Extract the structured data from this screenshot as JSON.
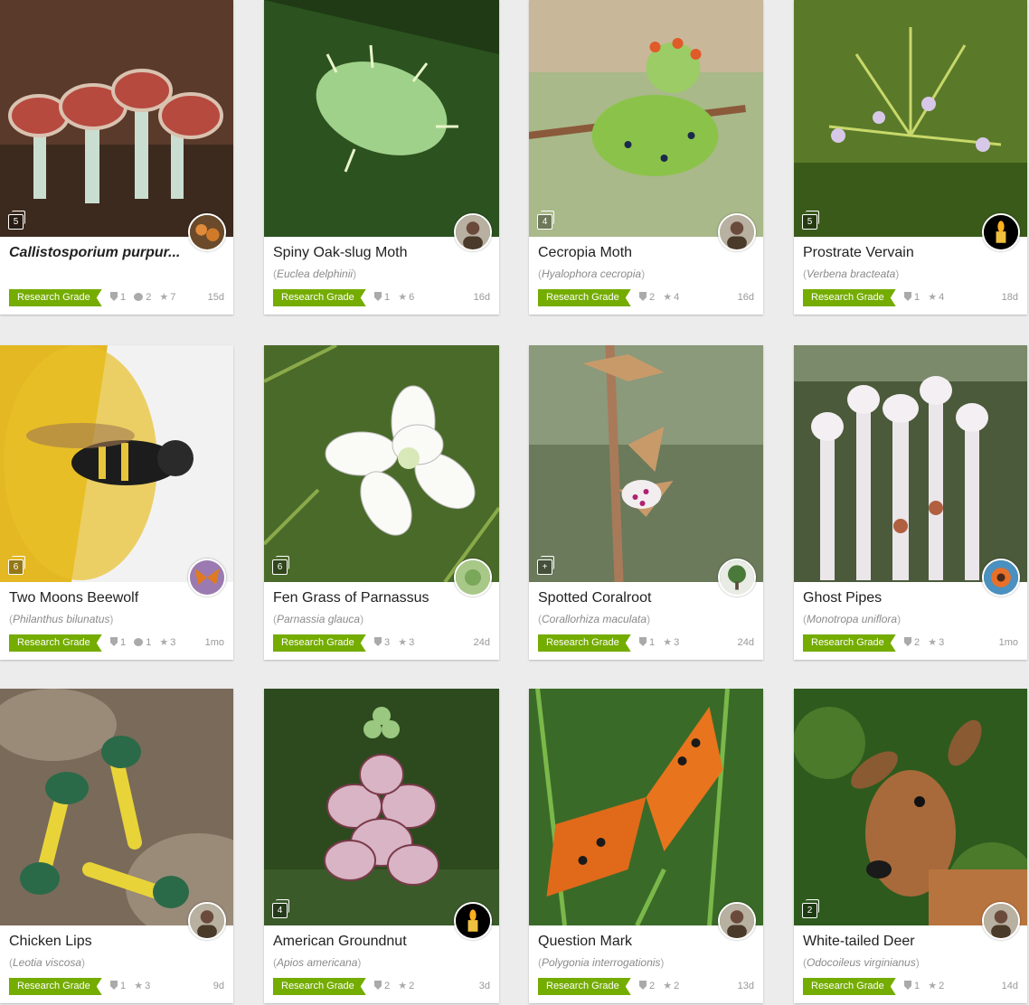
{
  "colors": {
    "research_grade": "#74ac00",
    "background": "#ececec",
    "card": "#ffffff"
  },
  "observations": [
    {
      "title": "Callistosporium purpur...",
      "title_italic": true,
      "scientific": "",
      "grade": "Research Grade",
      "ids": "1",
      "comments": "2",
      "faves": "7",
      "date": "15d",
      "photo_count": "5",
      "photo_icon": "mushroom-photo",
      "avatar_icon": "mushroom-avatar"
    },
    {
      "title": "Spiny Oak-slug Moth",
      "title_italic": false,
      "scientific": "Euclea delphinii",
      "grade": "Research Grade",
      "ids": "1",
      "comments": "",
      "faves": "6",
      "date": "16d",
      "photo_count": "",
      "photo_icon": "caterpillar-photo",
      "avatar_icon": "person-avatar"
    },
    {
      "title": "Cecropia Moth",
      "title_italic": false,
      "scientific": "Hyalophora cecropia",
      "grade": "Research Grade",
      "ids": "2",
      "comments": "",
      "faves": "4",
      "date": "16d",
      "photo_count": "4",
      "photo_icon": "caterpillar-photo",
      "avatar_icon": "person-avatar"
    },
    {
      "title": "Prostrate Vervain",
      "title_italic": false,
      "scientific": "Verbena bracteata",
      "grade": "Research Grade",
      "ids": "1",
      "comments": "",
      "faves": "4",
      "date": "18d",
      "photo_count": "5",
      "photo_icon": "plant-photo",
      "avatar_icon": "candle-avatar"
    },
    {
      "title": "Two Moons Beewolf",
      "title_italic": false,
      "scientific": "Philanthus bilunatus",
      "grade": "Research Grade",
      "ids": "1",
      "comments": "1",
      "faves": "3",
      "date": "1mo",
      "photo_count": "6",
      "photo_icon": "wasp-photo",
      "avatar_icon": "butterfly-avatar"
    },
    {
      "title": "Fen Grass of Parnassus",
      "title_italic": false,
      "scientific": "Parnassia glauca",
      "grade": "Research Grade",
      "ids": "3",
      "comments": "",
      "faves": "3",
      "date": "24d",
      "photo_count": "6",
      "photo_icon": "flower-photo",
      "avatar_icon": "plant-avatar"
    },
    {
      "title": "Spotted Coralroot",
      "title_italic": false,
      "scientific": "Corallorhiza maculata",
      "grade": "Research Grade",
      "ids": "1",
      "comments": "",
      "faves": "3",
      "date": "24d",
      "photo_count": "+",
      "photo_icon": "orchid-photo",
      "avatar_icon": "tree-avatar"
    },
    {
      "title": "Ghost Pipes",
      "title_italic": false,
      "scientific": "Monotropa uniflora",
      "grade": "Research Grade",
      "ids": "2",
      "comments": "",
      "faves": "3",
      "date": "1mo",
      "photo_count": "",
      "photo_icon": "ghost-pipe-photo",
      "avatar_icon": "flower-avatar"
    },
    {
      "title": "Chicken Lips",
      "title_italic": false,
      "scientific": "Leotia viscosa",
      "grade": "Research Grade",
      "ids": "1",
      "comments": "",
      "faves": "3",
      "date": "9d",
      "photo_count": "",
      "photo_icon": "fungus-photo",
      "avatar_icon": "person-avatar"
    },
    {
      "title": "American Groundnut",
      "title_italic": false,
      "scientific": "Apios americana",
      "grade": "Research Grade",
      "ids": "2",
      "comments": "",
      "faves": "2",
      "date": "3d",
      "photo_count": "4",
      "photo_icon": "flower-photo",
      "avatar_icon": "candle-avatar"
    },
    {
      "title": "Question Mark",
      "title_italic": false,
      "scientific": "Polygonia interrogationis",
      "grade": "Research Grade",
      "ids": "2",
      "comments": "",
      "faves": "2",
      "date": "13d",
      "photo_count": "",
      "photo_icon": "butterfly-photo",
      "avatar_icon": "person-avatar"
    },
    {
      "title": "White-tailed Deer",
      "title_italic": false,
      "scientific": "Odocoileus virginianus",
      "grade": "Research Grade",
      "ids": "1",
      "comments": "",
      "faves": "2",
      "date": "14d",
      "photo_count": "2",
      "photo_icon": "deer-photo",
      "avatar_icon": "person-avatar"
    }
  ]
}
